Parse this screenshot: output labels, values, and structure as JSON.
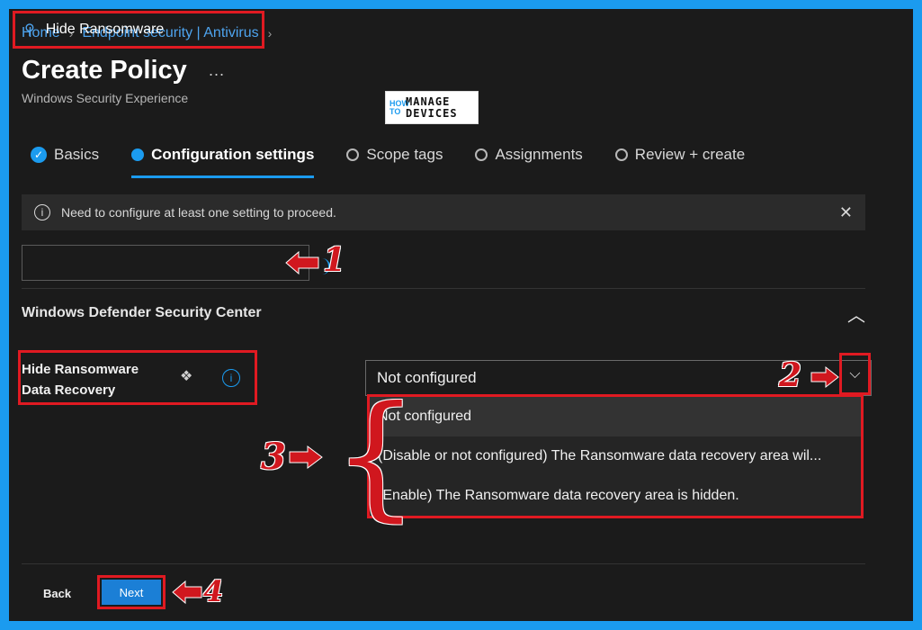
{
  "breadcrumb": [
    "Home",
    "Endpoint security | Antivirus"
  ],
  "page": {
    "title": "Create Policy",
    "subtitle": "Windows Security Experience",
    "more": "..."
  },
  "logo": {
    "small": "HOW TO",
    "main_line1": "MANAGE",
    "main_line2": "DEVICES"
  },
  "tabs": [
    {
      "label": "Basics",
      "state": "complete"
    },
    {
      "label": "Configuration settings",
      "state": "active"
    },
    {
      "label": "Scope tags",
      "state": "pending"
    },
    {
      "label": "Assignments",
      "state": "pending"
    },
    {
      "label": "Review + create",
      "state": "pending"
    }
  ],
  "infobar": {
    "text": "Need to configure at least one setting to proceed."
  },
  "search": {
    "value": "Hide Ransomware"
  },
  "section": {
    "title": "Windows Defender Security Center"
  },
  "setting": {
    "label_line1": "Hide Ransomware",
    "label_line2": "Data Recovery",
    "selected": "Not configured",
    "options": [
      "Not configured",
      "(Disable or not configured) The Ransomware data recovery area wil...",
      "(Enable) The Ransomware data recovery area is hidden."
    ]
  },
  "annotations": {
    "n1": "1",
    "n2": "2",
    "n3": "3",
    "n4": "4"
  },
  "footer": {
    "back": "Back",
    "next": "Next"
  },
  "colors": {
    "accent": "#1b9bef",
    "highlight": "#e01a22",
    "background": "#1b1b1b"
  }
}
